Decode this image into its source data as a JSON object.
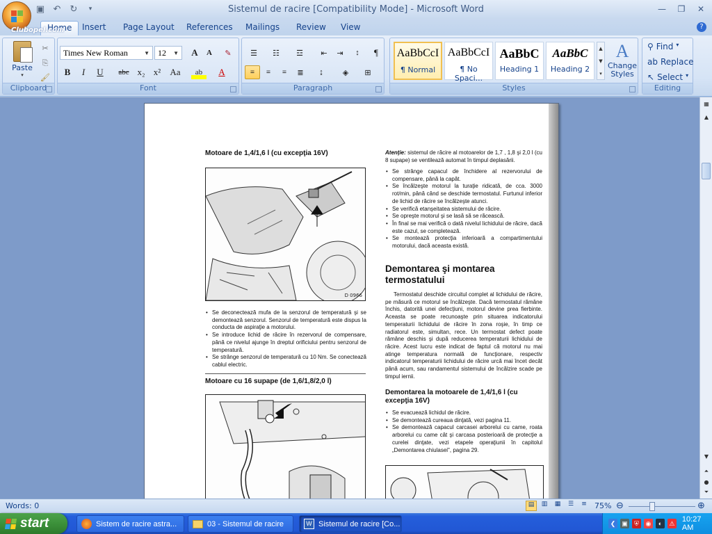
{
  "window": {
    "title": "Sistemul de racire [Compatibility Mode] - Microsoft Word",
    "watermark": "Clubopel.com"
  },
  "quick_access": {
    "save": "save-icon",
    "undo": "undo-icon",
    "redo": "redo-icon"
  },
  "ribbon_tabs": [
    "Home",
    "Insert",
    "Page Layout",
    "References",
    "Mailings",
    "Review",
    "View"
  ],
  "clipboard": {
    "paste_label": "Paste",
    "group_label": "Clipboard"
  },
  "font": {
    "name": "Times New Roman",
    "size": "12",
    "group_label": "Font",
    "bold": "B",
    "italic": "I",
    "underline": "U",
    "strike": "abc",
    "sub": "x₂",
    "sup": "x²",
    "case": "Aa",
    "grow": "A",
    "shrink": "A"
  },
  "paragraph": {
    "group_label": "Paragraph",
    "pilcrow": "¶"
  },
  "styles": {
    "group_label": "Styles",
    "items": [
      {
        "preview": "AaBbCcI",
        "name": "¶ Normal"
      },
      {
        "preview": "AaBbCcI",
        "name": "¶ No Spaci..."
      },
      {
        "preview": "AaBbC",
        "name": "Heading 1"
      },
      {
        "preview": "AaBbC",
        "name": "Heading 2"
      }
    ],
    "change_styles": "Change Styles"
  },
  "editing": {
    "group_label": "Editing",
    "find": "Find",
    "replace": "Replace",
    "select": "Select"
  },
  "document": {
    "left_heading_1": "Motoare de 1,4/1,6 l (cu excepţia 16V)",
    "fig1_code": "D 0966",
    "left_bullets": [
      "Se deconectează mufa de la senzorul de temperatură şi se demontează senzorul. Senzorul de temperatură este dispus la conducta de aspiraţie a motorului.",
      "Se introduce lichid de răcire în rezervorul de compensare, până ce nivelul ajunge în dreptul orificiului pentru senzorul de temperatură.",
      "Se strânge senzorul de temperatură cu 10 Nm. Se conectează cablul electric."
    ],
    "left_heading_2": "Motoare cu 16 supape (de 1,6/1,8/2,0 l)",
    "attention_label": "Atenţie:",
    "attention_text": "sistemul de răcire al motoarelor de 1,7 , 1,8 şi 2,0 l (cu 8 supape) se ventilează automat în timpul deplasării.",
    "right_bullets_1": [
      "Se strânge capacul de închidere al rezervorului de compensare, până la capăt.",
      "Se încălzeşte motorul la turaţie ridicată, de cca. 3000 rot/min, până când se deschide termostatul. Furtunul inferior de lichid de răcire se încălzeşte atunci.",
      "Se verifică etanşeitatea sistemului de răcire.",
      "Se opreşte motorul şi se lasă să se răcească.",
      "În final se mai verifică o dată nivelul lichidului de răcire, dacă este cazul, se completează.",
      "Se montează protecţia inferioară a compartimentului motorului, dacă aceasta există."
    ],
    "right_heading": "Demontarea şi montarea termostatului",
    "right_paragraph": "Termostatul deschide circuitul complet al lichidului de răcire, pe măsură ce motorul se încălzeşte. Dacă termostatul rămâne închis, datorită unei defecţiuni, motorul devine prea fierbinte. Aceasta se poate recunoaşte prin situarea indicatorului temperaturii lichidului de răcire în zona roşie, în timp ce radiatorul este, simultan, rece. Un termostat defect poate rămâne deschis şi după reducerea temperaturii lichidului de răcire. Acest lucru este indicat de faptul că motorul nu mai atinge temperatura normală de funcţionare, respectiv indicatorul temperaturii lichidului de răcire urcă mai încet decât până acum, sau randamentul sistemului de încălzire scade pe timpul iernii.",
    "right_subheading": "Demontarea la motoarele de 1,4/1,6 l (cu excepţia 16V)",
    "right_bullets_2": [
      "Se evacuează lichidul de răcire.",
      "Se demontează cureaua dinţată, vezi pagina 11.",
      "Se demontează capacul carcasei arborelui cu came, roata arborelui cu came cât şi carcasa posterioară de protecţie a curelei dinţate, vezi etapele operaţiunii în capitolul „Demontarea chiulasei\", pagina 29."
    ]
  },
  "status": {
    "words": "Words: 0",
    "zoom": "75%"
  },
  "taskbar": {
    "start": "start",
    "tasks": [
      "Sistem de racire astra...",
      "03 - Sistemul de racire",
      "Sistemul de racire [Co..."
    ],
    "clock": "10:27 AM"
  }
}
